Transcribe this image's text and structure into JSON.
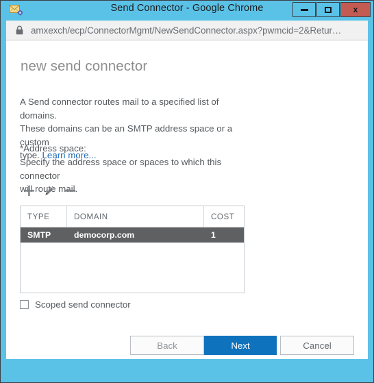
{
  "window": {
    "title": "Send Connector - Google Chrome",
    "icon": "send-connector-envelope-gear-icon",
    "controls": {
      "minimize": "minimize-icon",
      "maximize": "maximize-icon",
      "close": "x"
    }
  },
  "address_bar": {
    "security_icon": "lock-icon",
    "url": "amxexch/ecp/ConnectorMgmt/NewSendConnector.aspx?pwmcid=2&Retur…"
  },
  "page": {
    "title": "new send connector",
    "intro_line1": "A Send connector routes mail to a specified list of domains.",
    "intro_line2": "These domains can be an SMTP address space or a custom",
    "intro_line3_prefix": "type. ",
    "learn_more": "Learn more...",
    "address_space_label": "*Address space:",
    "address_space_help_line1": "Specify the address space or spaces to which this connector",
    "address_space_help_line2": "will route mail."
  },
  "toolbar": {
    "add_icon": "plus-icon",
    "edit_icon": "pencil-icon",
    "remove_icon": "minus-icon"
  },
  "table": {
    "columns": [
      "TYPE",
      "DOMAIN",
      "COST"
    ],
    "rows": [
      {
        "type": "SMTP",
        "domain": "democorp.com",
        "cost": "1",
        "selected": true
      }
    ]
  },
  "checkbox": {
    "label": "Scoped send connector",
    "checked": false
  },
  "footer": {
    "back": "Back",
    "next": "Next",
    "cancel": "Cancel"
  },
  "colors": {
    "titlebar": "#5bc2e7",
    "close_button": "#c45b52",
    "primary_button": "#0f72bd",
    "link": "#1e6bb8",
    "selected_row": "#5f6062"
  }
}
